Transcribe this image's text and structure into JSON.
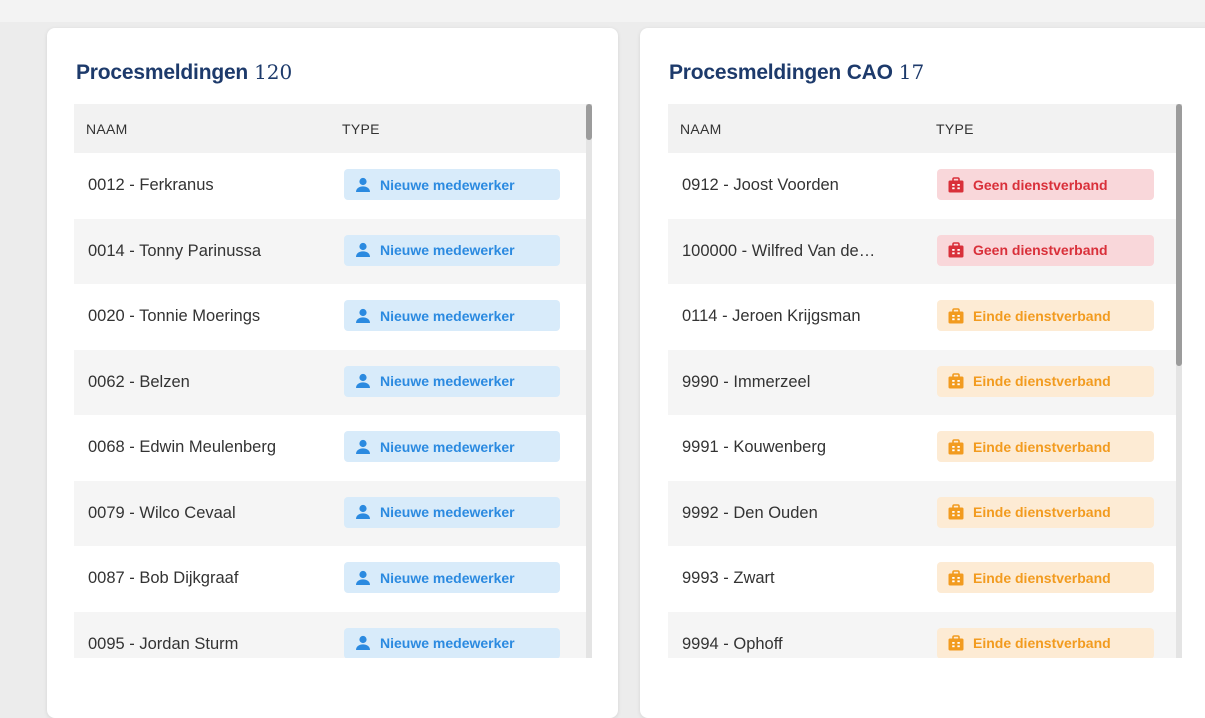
{
  "left_panel": {
    "title": "Procesmeldingen",
    "count": "120",
    "columns": {
      "name": "NAAM",
      "type": "TYPE"
    },
    "rows": [
      {
        "name": "0012 - Ferkranus",
        "type": "Nieuwe medewerker",
        "icon": "user-icon"
      },
      {
        "name": "0014 - Tonny Parinussa",
        "type": "Nieuwe medewerker",
        "icon": "user-icon"
      },
      {
        "name": "0020 - Tonnie Moerings",
        "type": "Nieuwe medewerker",
        "icon": "user-icon"
      },
      {
        "name": "0062 - Belzen",
        "type": "Nieuwe medewerker",
        "icon": "user-icon"
      },
      {
        "name": "0068 - Edwin Meulenberg",
        "type": "Nieuwe medewerker",
        "icon": "user-icon"
      },
      {
        "name": "0079 - Wilco Cevaal",
        "type": "Nieuwe medewerker",
        "icon": "user-icon"
      },
      {
        "name": "0087 - Bob Dijkgraaf",
        "type": "Nieuwe medewerker",
        "icon": "user-icon"
      },
      {
        "name": "0095 - Jordan Sturm",
        "type": "Nieuwe medewerker",
        "icon": "user-icon"
      }
    ]
  },
  "right_panel": {
    "title": "Procesmeldingen CAO",
    "count": "17",
    "columns": {
      "name": "NAAM",
      "type": "TYPE"
    },
    "rows": [
      {
        "name": "0912 - Joost Voorden",
        "type": "Geen dienstverband",
        "icon": "briefcase-icon",
        "status": "red"
      },
      {
        "name": "100000 - Wilfred Van de…",
        "type": "Geen dienstverband",
        "icon": "briefcase-icon",
        "status": "red"
      },
      {
        "name": "0114 - Jeroen Krijgsman",
        "type": "Einde dienstverband",
        "icon": "briefcase-icon",
        "status": "orange"
      },
      {
        "name": "9990 - Immerzeel",
        "type": "Einde dienstverband",
        "icon": "briefcase-icon",
        "status": "orange"
      },
      {
        "name": "9991 - Kouwenberg",
        "type": "Einde dienstverband",
        "icon": "briefcase-icon",
        "status": "orange"
      },
      {
        "name": "9992 - Den Ouden",
        "type": "Einde dienstverband",
        "icon": "briefcase-icon",
        "status": "orange"
      },
      {
        "name": "9993 - Zwart",
        "type": "Einde dienstverband",
        "icon": "briefcase-icon",
        "status": "orange"
      },
      {
        "name": "9994 - Ophoff",
        "type": "Einde dienstverband",
        "icon": "briefcase-icon",
        "status": "orange"
      }
    ]
  },
  "colors": {
    "title": "#1d3a6b",
    "blue_badge_bg": "#d8ebfa",
    "blue_badge_text": "#2b8ae0",
    "red_badge_bg": "#f9d7da",
    "red_badge_text": "#d9303a",
    "orange_badge_bg": "#fdebd4",
    "orange_badge_text": "#f29b1f"
  }
}
